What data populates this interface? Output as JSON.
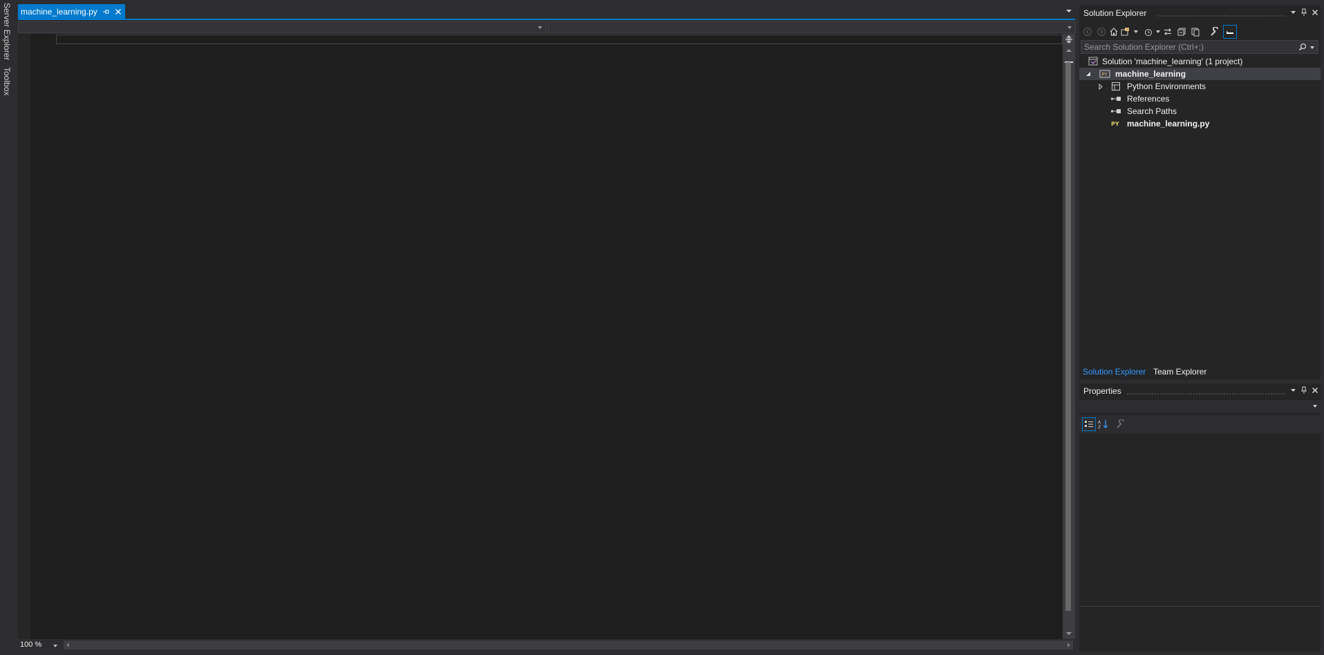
{
  "left_strip": {
    "server_explorer": "Server Explorer",
    "toolbox": "Toolbox"
  },
  "editor": {
    "tab_title": "machine_learning.py",
    "zoom": "100 %"
  },
  "solution_explorer": {
    "title": "Solution Explorer",
    "search_placeholder": "Search Solution Explorer (Ctrl+;)",
    "tree": {
      "solution": "Solution 'machine_learning' (1 project)",
      "project": "machine_learning",
      "python_envs": "Python Environments",
      "references": "References",
      "search_paths": "Search Paths",
      "file": "machine_learning.py"
    },
    "bottom_tabs": {
      "solution_explorer": "Solution Explorer",
      "team_explorer": "Team Explorer"
    }
  },
  "properties": {
    "title": "Properties"
  },
  "colors": {
    "accent": "#007acc",
    "background": "#2d2d30",
    "editor": "#1e1e1e",
    "panel": "#252526"
  }
}
